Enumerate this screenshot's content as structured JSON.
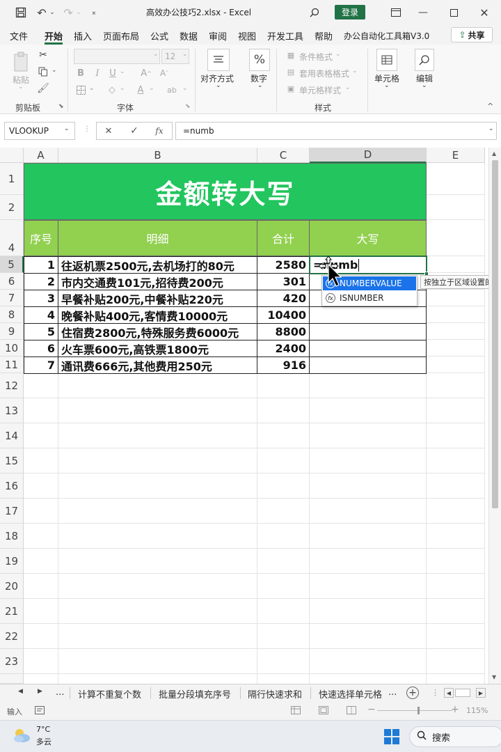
{
  "titlebar": {
    "filename": "高效办公技巧2.xlsx",
    "separator": "-",
    "app": "Excel",
    "login_label": "登录"
  },
  "menu_tabs": [
    "文件",
    "开始",
    "插入",
    "页面布局",
    "公式",
    "数据",
    "审阅",
    "视图",
    "开发工具",
    "帮助",
    "办公自动化工具箱V3.0"
  ],
  "share_label": "共享",
  "ribbon": {
    "paste_label": "粘贴",
    "clipboard_label": "剪贴板",
    "font_label": "字体",
    "font_size": "12",
    "align_label": "对齐方式",
    "number_label": "数字",
    "conditional_format": "条件格式",
    "table_format": "套用表格格式",
    "cell_style": "单元格样式",
    "style_label": "样式",
    "cells_label": "单元格",
    "edit_label": "编辑"
  },
  "formula_bar": {
    "name_box": "VLOOKUP",
    "fx": "fx",
    "formula": "=numb"
  },
  "columns": [
    "A",
    "B",
    "C",
    "D",
    "E"
  ],
  "rows": [
    "1",
    "2",
    "4",
    "5",
    "6",
    "7",
    "8",
    "9",
    "10",
    "11",
    "12",
    "13",
    "14",
    "15",
    "16",
    "17",
    "18",
    "19",
    "20",
    "21",
    "22",
    "23"
  ],
  "table": {
    "title": "金额转大写",
    "headers": [
      "序号",
      "明细",
      "合计",
      "大写"
    ],
    "records": [
      {
        "no": "1",
        "detail": "往返机票2500元,去机场打的80元",
        "total": "2580"
      },
      {
        "no": "2",
        "detail": "市内交通费101元,招待费200元",
        "total": "301"
      },
      {
        "no": "3",
        "detail": "早餐补贴200元,中餐补贴220元",
        "total": "420"
      },
      {
        "no": "4",
        "detail": "晚餐补贴400元,客情费10000元",
        "total": "10400"
      },
      {
        "no": "5",
        "detail": "住宿费2800元,特殊服务费6000元",
        "total": "8800"
      },
      {
        "no": "6",
        "detail": "火车票600元,高铁票1800元",
        "total": "2400"
      },
      {
        "no": "7",
        "detail": "通讯费666元,其他费用250元",
        "total": "916"
      }
    ],
    "editing_value": "=numb"
  },
  "autocomplete": {
    "items": [
      "NUMBERVALUE",
      "ISNUMBER"
    ],
    "tooltip": "按独立于区域设置的方"
  },
  "sheet_tabs": [
    "计算不重复个数",
    "批量分段填充序号",
    "隔行快速求和",
    "快速选择单元格"
  ],
  "sheet_nav": {
    "ellipsis": "...",
    "more": "..."
  },
  "status": {
    "mode": "输入",
    "zoom": "115%"
  },
  "taskbar": {
    "temp": "7°C",
    "weather": "多云",
    "search": "搜索"
  },
  "colors": {
    "title_green": "#22c55e",
    "header_green": "#92d050",
    "accent": "#217346",
    "selected": "#1a73e8"
  }
}
